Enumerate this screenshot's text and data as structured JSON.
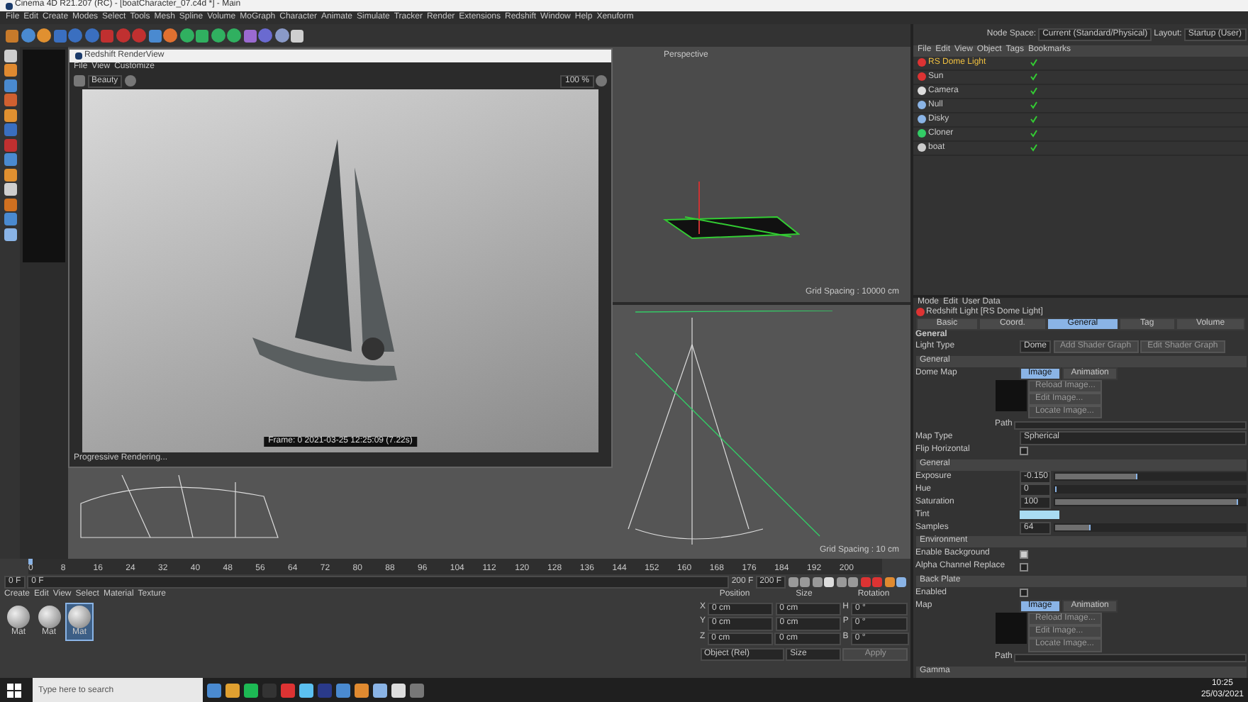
{
  "window": {
    "title": "Cinema 4D R21.207 (RC) - [boatCharacter_07.c4d *] - Main"
  },
  "menu": [
    "File",
    "Edit",
    "Create",
    "Modes",
    "Select",
    "Tools",
    "Mesh",
    "Spline",
    "Volume",
    "MoGraph",
    "Character",
    "Animate",
    "Simulate",
    "Tracker",
    "Render",
    "Extensions",
    "Redshift",
    "Window",
    "Help",
    "Xenuform"
  ],
  "node_space": {
    "label": "Node Space:",
    "value": "Current (Standard/Physical)"
  },
  "layout": {
    "label": "Layout:",
    "value": "Startup (User)"
  },
  "viewport": {
    "title": "Perspective",
    "grid_top": "Grid Spacing : 10000 cm",
    "grid_bottom": "Grid Spacing : 10 cm"
  },
  "render_view": {
    "title": "Redshift RenderView",
    "menu": [
      "File",
      "View",
      "Customize"
    ],
    "pass": "Beauty",
    "zoom": "100 %",
    "frame_info": "Frame: 0  2021-03-25  12:25:09  (7.22s)",
    "status": "Progressive Rendering..."
  },
  "object_manager": {
    "menu": [
      "File",
      "Edit",
      "View",
      "Object",
      "Tags",
      "Bookmarks"
    ],
    "objects": [
      {
        "name": "RS Dome Light",
        "kind": "light",
        "selected": true
      },
      {
        "name": "Sun",
        "kind": "light",
        "selected": false
      },
      {
        "name": "Camera",
        "kind": "camera",
        "selected": false
      },
      {
        "name": "Null",
        "kind": "null",
        "selected": false
      },
      {
        "name": "Disky",
        "kind": "null",
        "selected": false
      },
      {
        "name": "Cloner",
        "kind": "cloner",
        "selected": false
      },
      {
        "name": "boat",
        "kind": "mesh",
        "selected": false
      }
    ]
  },
  "attributes": {
    "menu": [
      "Mode",
      "Edit",
      "User Data"
    ],
    "object_title": "Redshift Light [RS Dome Light]",
    "tabs": [
      {
        "label": "Basic",
        "selected": false
      },
      {
        "label": "Coord.",
        "selected": false
      },
      {
        "label": "General",
        "selected": true
      },
      {
        "label": "Tag",
        "selected": false
      },
      {
        "label": "Volume",
        "selected": false
      }
    ],
    "section": "General",
    "light_type": {
      "label": "Light Type",
      "value": "Dome"
    },
    "buttons": [
      "Add Shader Graph",
      "Edit Shader Graph"
    ],
    "rows": [
      {
        "kind": "header",
        "label": "General"
      },
      {
        "kind": "image",
        "label": "Dome Map",
        "tabs": [
          {
            "label": "Image",
            "selected": true
          },
          {
            "label": "Animation",
            "selected": false
          }
        ],
        "buttons": [
          "Reload Image...",
          "Edit Image...",
          "Locate Image..."
        ],
        "path_label": "Path"
      },
      {
        "kind": "dropdown",
        "label": "Map Type",
        "value": "Spherical"
      },
      {
        "kind": "checkbox",
        "label": "Flip Horizontal",
        "checked": false
      },
      {
        "kind": "header",
        "label": "General"
      },
      {
        "kind": "slider",
        "label": "Exposure",
        "value": "-0.150",
        "level": 0.45
      },
      {
        "kind": "slider",
        "label": "Hue",
        "value": "0",
        "level": 0
      },
      {
        "kind": "slider",
        "label": "Saturation",
        "value": "100",
        "level": 1
      },
      {
        "kind": "color",
        "label": "Tint",
        "color": "#a9dcf2"
      },
      {
        "kind": "slider",
        "label": "Samples",
        "value": "64",
        "level": 0.2
      },
      {
        "kind": "header",
        "label": "Environment"
      },
      {
        "kind": "checkbox",
        "label": "Enable Background",
        "checked": true
      },
      {
        "kind": "checkbox",
        "label": "Alpha Channel Replace",
        "checked": false
      },
      {
        "kind": "header",
        "label": "Back Plate"
      },
      {
        "kind": "checkbox",
        "label": "Enabled",
        "checked": false
      },
      {
        "kind": "image",
        "label": "Map",
        "tabs": [
          {
            "label": "Image",
            "selected": true
          },
          {
            "label": "Animation",
            "selected": false
          }
        ],
        "buttons": [
          "Reload Image...",
          "Edit Image...",
          "Locate Image..."
        ],
        "path_label": "Path"
      },
      {
        "kind": "header",
        "label": "Gamma"
      }
    ]
  },
  "timeline": {
    "ticks": [
      "0",
      "8",
      "16",
      "24",
      "32",
      "40",
      "48",
      "56",
      "64",
      "72",
      "80",
      "88",
      "96",
      "104",
      "112",
      "120",
      "128",
      "136",
      "144",
      "152",
      "160",
      "168",
      "176",
      "184",
      "192",
      "200"
    ],
    "current": "0 F",
    "start": "0 F",
    "end": "200 F",
    "end_field": "200 F",
    "level": 0
  },
  "materials": {
    "menu": [
      "Create",
      "Edit",
      "View",
      "Select",
      "Material",
      "Texture"
    ],
    "items": [
      {
        "name": "Mat",
        "selected": false
      },
      {
        "name": "Mat",
        "selected": false
      },
      {
        "name": "Mat",
        "selected": true
      }
    ]
  },
  "coordinates": {
    "headers": [
      "Position",
      "Size",
      "Rotation"
    ],
    "rows": [
      {
        "axis": "X",
        "position": "0 cm",
        "size": "0 cm",
        "rot_axis": "H",
        "rotation": "0 °"
      },
      {
        "axis": "Y",
        "position": "0 cm",
        "size": "0 cm",
        "rot_axis": "P",
        "rotation": "0 °"
      },
      {
        "axis": "Z",
        "position": "0 cm",
        "size": "0 cm",
        "rot_axis": "B",
        "rotation": "0 °"
      }
    ],
    "mode": "Object (Rel)",
    "size_mode": "Size",
    "apply": "Apply"
  },
  "taskbar": {
    "search_placeholder": "Type here to search",
    "time": "10:25",
    "date": "25/03/2021"
  }
}
